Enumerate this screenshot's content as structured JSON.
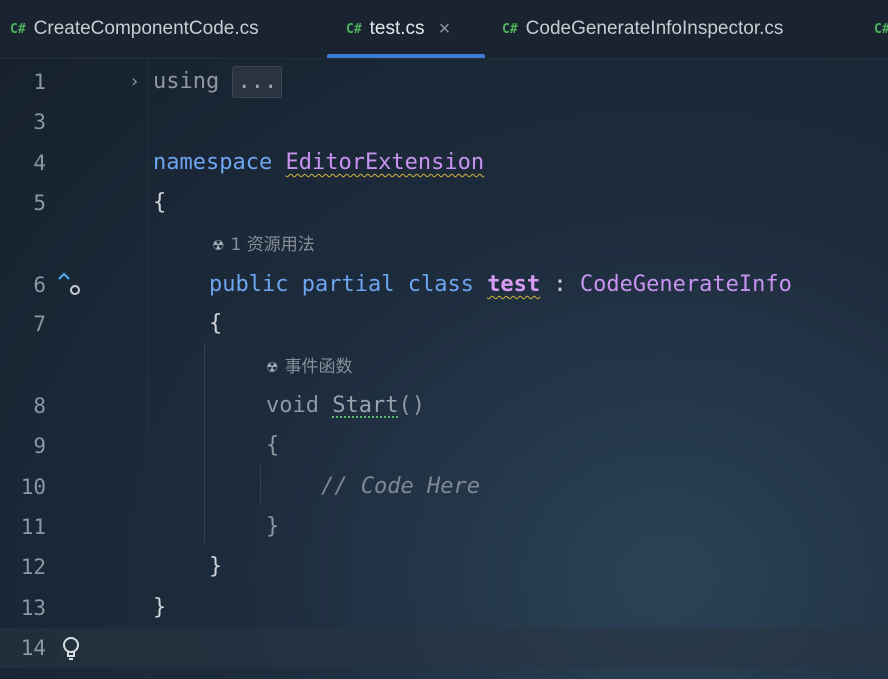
{
  "tabs": [
    {
      "icon": "C#",
      "label": "CreateComponentCode.cs"
    },
    {
      "icon": "C#",
      "label": "test.cs",
      "close": "×"
    },
    {
      "icon": "C#",
      "label": "CodeGenerateInfoInspector.cs"
    },
    {
      "icon": "C#",
      "label": ""
    }
  ],
  "line_numbers": [
    "1",
    "3",
    "4",
    "5",
    "6",
    "7",
    "8",
    "9",
    "10",
    "11",
    "12",
    "13",
    "14"
  ],
  "code": {
    "l1_kw": "using",
    "l1_collapsed": "...",
    "l4_kw": "namespace",
    "l4_name": "EditorExtension",
    "l5": "{",
    "hint1": "1 资源用法",
    "l6_kw1": "public",
    "l6_kw2": "partial",
    "l6_kw3": "class",
    "l6_name": "test",
    "l6_colon": ":",
    "l6_base": "CodeGenerateInfo",
    "l7": "{",
    "hint2": "事件函数",
    "l8_kw": "void",
    "l8_method": "Start",
    "l8_parens": "()",
    "l9": "{",
    "l10": "// Code Here",
    "l11": "}",
    "l12": "}",
    "l13": "}"
  },
  "gutter_icons": [
    "fold-arrow-icon",
    "implementation-up-icon",
    "lightbulb-icon",
    "unity-icon"
  ]
}
